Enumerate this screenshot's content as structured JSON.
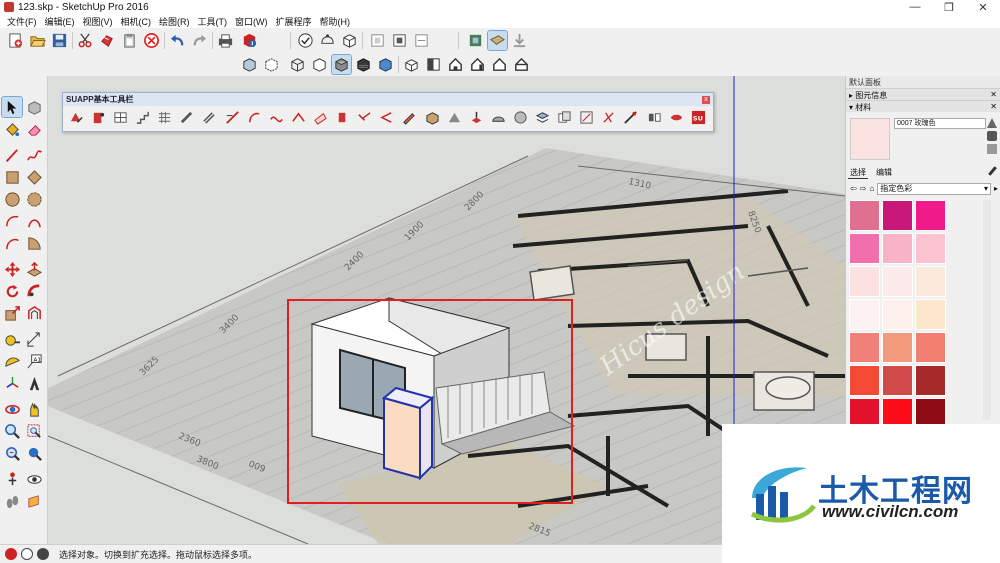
{
  "window": {
    "title": "123.skp - SketchUp Pro 2016",
    "minimize": "—",
    "maximize": "❐",
    "close": "✕"
  },
  "menu": [
    "文件(F)",
    "编辑(E)",
    "视图(V)",
    "相机(C)",
    "绘图(R)",
    "工具(T)",
    "窗口(W)",
    "扩展程序",
    "帮助(H)"
  ],
  "suapp": {
    "title": "SUAPP基本工具栏",
    "close": "x"
  },
  "tray": {
    "title": "默认面板",
    "section_entity": "图元信息",
    "section_material": "材料",
    "material_name": "0007 玫瑰色",
    "tab_select": "选择",
    "tab_edit": "编辑",
    "collection": "指定色彩",
    "swatches": [
      "#e0708f",
      "#c8197a",
      "#f01a8a",
      "#f26fae",
      "#f9b3c7",
      "#fac3cf",
      "#fce1e1",
      "#fdebeb",
      "#fbe9dc",
      "#fdf1f1",
      "#fcefec",
      "#fde7cc",
      "#f08078",
      "#f29a7c",
      "#f28070",
      "#f24a34",
      "#d04a4a",
      "#a52a2a",
      "#e3122b",
      "#fc0d1a",
      "#8e0b14"
    ]
  },
  "viewport": {
    "dims": [
      "1310",
      "8250",
      "2800",
      "1900",
      "2400",
      "3400",
      "3625",
      "2360",
      "3800",
      "009",
      "2815"
    ],
    "plan_watermark": "Hicus design"
  },
  "watermark": {
    "name": "土木工程网",
    "url": "www.civilcn.com"
  },
  "status": {
    "text": "选择对象。切换到扩充选择。拖动鼠标选择多项。"
  },
  "colors": {
    "selection_blue": "#2233aa",
    "zoom_frame": "#e02020",
    "axis_blue": "#2020c0"
  }
}
